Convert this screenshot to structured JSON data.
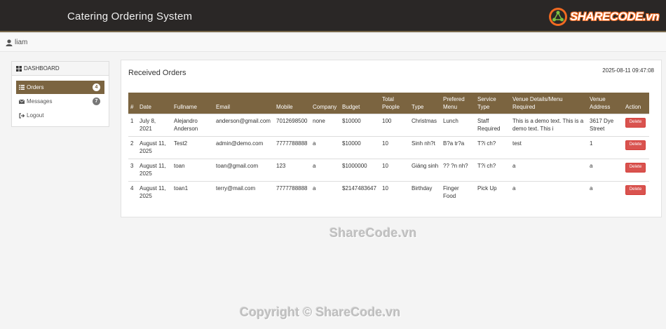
{
  "app": {
    "title": "Catering Ordering System",
    "logo_text": "SHARECODE.vn"
  },
  "user": {
    "name": "liam"
  },
  "sidebar": {
    "heading": "DASHBOARD",
    "items": [
      {
        "label": "Orders",
        "badge": "4",
        "icon": "list-icon"
      },
      {
        "label": "Messages",
        "badge": "7",
        "icon": "envelope-icon"
      },
      {
        "label": "Logout",
        "icon": "logout-icon"
      }
    ]
  },
  "main": {
    "title": "Received Orders",
    "timestamp": "2025-08-11 09:47:08",
    "columns": [
      "#",
      "Date",
      "Fullname",
      "Email",
      "Mobile",
      "Company",
      "Budget",
      "Total People",
      "Type",
      "Prefered Menu",
      "Service Type",
      "Venue Details/Menu Required",
      "Venue Address",
      "Action"
    ],
    "rows": [
      [
        "1",
        "July 8, 2021",
        "Alejandro Anderson",
        "anderson@gmail.com",
        "7012698500",
        "none",
        "$10000",
        "100",
        "Christmas",
        "Lunch",
        "Staff Required",
        "This is a demo text. This is a demo text. This i",
        "3617 Dye Street",
        "Delete"
      ],
      [
        "2",
        "August 11, 2025",
        "Test2",
        "admin@demo.com",
        "7777788888",
        "a",
        "$10000",
        "10",
        "Sinh nh?t",
        "B?a tr?a",
        "T?i ch?",
        "test",
        "1",
        "Delete"
      ],
      [
        "3",
        "August 11, 2025",
        "toan",
        "toan@gmail.com",
        "123",
        "a",
        "$1000000",
        "10",
        "Giáng sinh",
        "?? ?n nh?",
        "T?i ch?",
        "a",
        "a",
        "Delete"
      ],
      [
        "4",
        "August 11, 2025",
        "toan1",
        "terry@mail.com",
        "7777788888",
        "a",
        "$2147483647",
        "10",
        "Birthday",
        "Finger Food",
        "Pick Up",
        "a",
        "a",
        "Delete"
      ]
    ]
  },
  "watermarks": {
    "center": "ShareCode.vn",
    "footer": "Copyright © ShareCode.vn"
  },
  "colors": {
    "navbar": "#2a2726",
    "accent": "#7b6440",
    "danger": "#d9534f",
    "logo": "#f26a21"
  }
}
